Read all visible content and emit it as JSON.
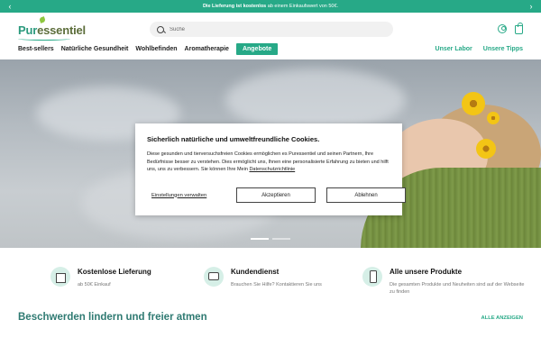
{
  "promo": {
    "text_bold": "Die Lieferung ist kostenlos",
    "text_rest": " ab einem Einkaufswert von 50€.",
    "prev_icon": "chevron-left-icon",
    "next_icon": "chevron-right-icon",
    "prev_glyph": "‹",
    "next_glyph": "›"
  },
  "header": {
    "logo_first": "Pur",
    "logo_rest": "essentiel",
    "search_placeholder": "Suche"
  },
  "nav": {
    "items": [
      "Best-sellers",
      "Natürliche Gesundheit",
      "Wohlbefinden",
      "Aromatherapie",
      "Angebote"
    ],
    "right_links": [
      "Unser Labor",
      "Unsere Tipps"
    ]
  },
  "cookie": {
    "title": "Sicherlich natürliche und umweltfreundliche Cookies.",
    "body": "Diese gesunden und tierversuchsfreien Cookies ermöglichen es Puressentiel und seinen Partnern, Ihre Bedürfnisse besser zu verstehen. Dies ermöglicht uns, Ihnen eine personalisierte Erfahrung zu bieten und hilft uns, uns zu verbessern. Sie können Ihre Mein ",
    "privacy_link": "Datenschutzrichtlinie",
    "settings": "Einstellungen verwalten",
    "accept": "Akzeptieren",
    "reject": "Ablehnen"
  },
  "features": [
    {
      "title": "Kostenlose Lieferung",
      "subtitle": "ab 50€ Einkauf"
    },
    {
      "title": "Kundendienst",
      "subtitle": "Brauchen Sie Hilfe? Kontaktieren Sie uns"
    },
    {
      "title": "Alle unsere Produkte",
      "subtitle": "Die gesamten Produkte und Neuheiten sind auf der Webseite zu finden"
    }
  ],
  "section": {
    "title": "Beschwerden lindern und freier atmen",
    "see_all": "ALLE ANZEIGEN"
  },
  "colors": {
    "accent": "#27a987",
    "section_title": "#2f7a72"
  }
}
